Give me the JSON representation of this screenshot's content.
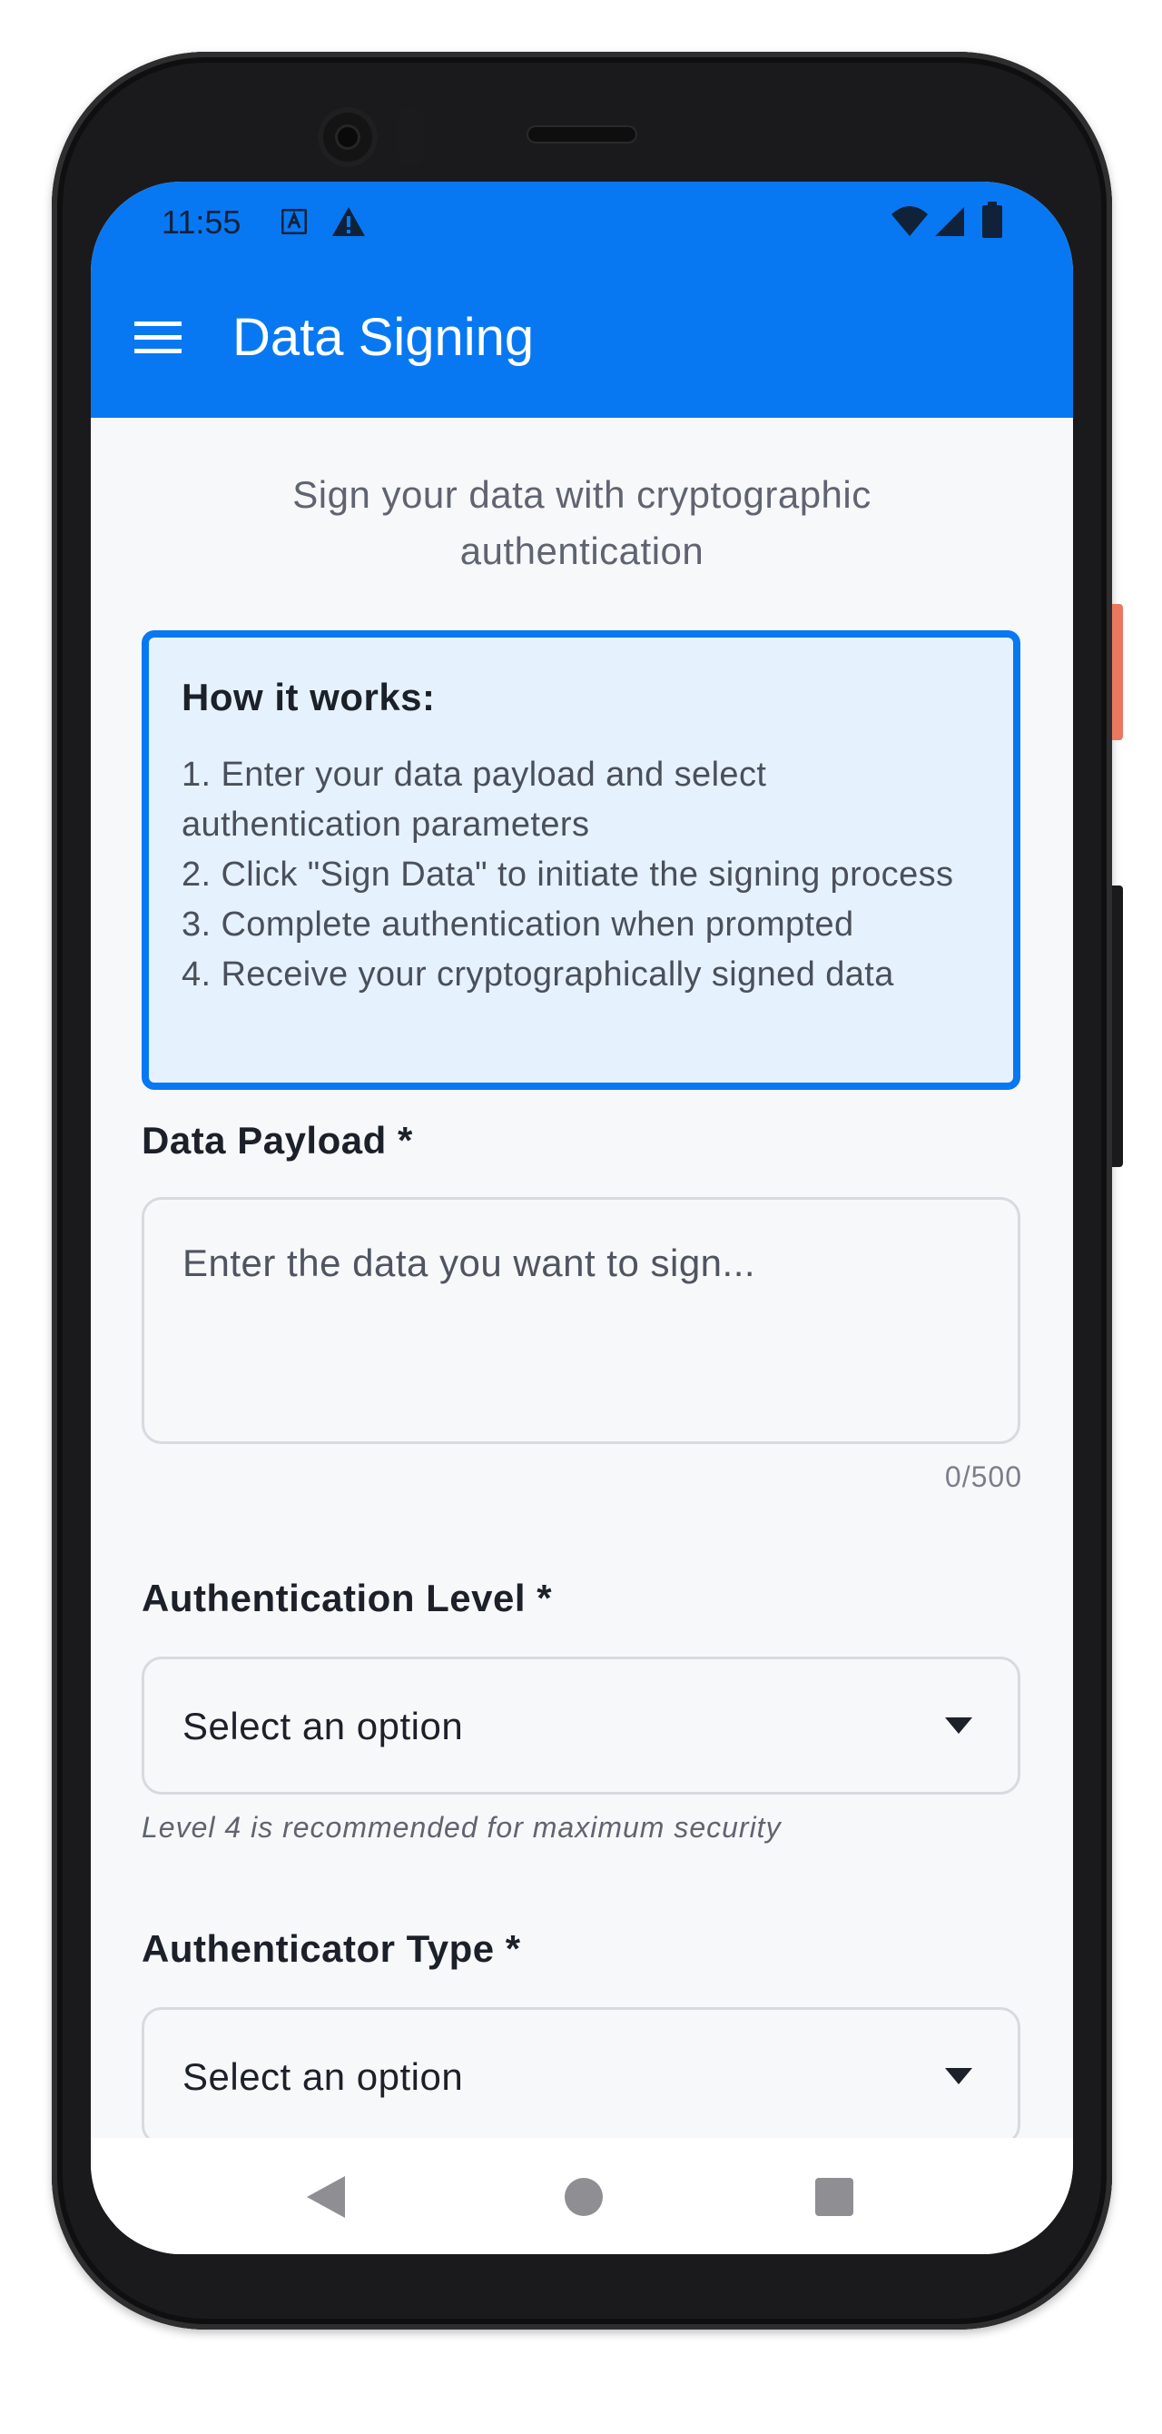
{
  "status_bar": {
    "time": "11:55",
    "icons": [
      "accessibility-a-icon",
      "warning-icon",
      "wifi-icon",
      "cell-signal-icon",
      "battery-icon"
    ]
  },
  "app_bar": {
    "title": "Data Signing",
    "background": "#0878f2"
  },
  "page": {
    "subtitle": "Sign your data with cryptographic authentication"
  },
  "info_box": {
    "title": "How it works:",
    "steps": [
      "1. Enter your data payload and select authentication parameters",
      "2. Click \"Sign Data\" to initiate the signing process",
      "3. Complete authentication when prompted",
      "4. Receive your cryptographically signed data"
    ]
  },
  "form": {
    "payload": {
      "label": "Data Payload *",
      "placeholder": "Enter the data you want to sign...",
      "value": "",
      "counter": "0/500"
    },
    "auth_level": {
      "label": "Authentication Level *",
      "selected": "Select an option",
      "hint": "Level 4 is recommended for maximum security"
    },
    "authenticator_type": {
      "label": "Authenticator Type *",
      "selected": "Select an option"
    }
  },
  "colors": {
    "accent": "#0878f2",
    "info_bg": "#e5f2fd",
    "screen_bg": "#f7f8fa"
  }
}
